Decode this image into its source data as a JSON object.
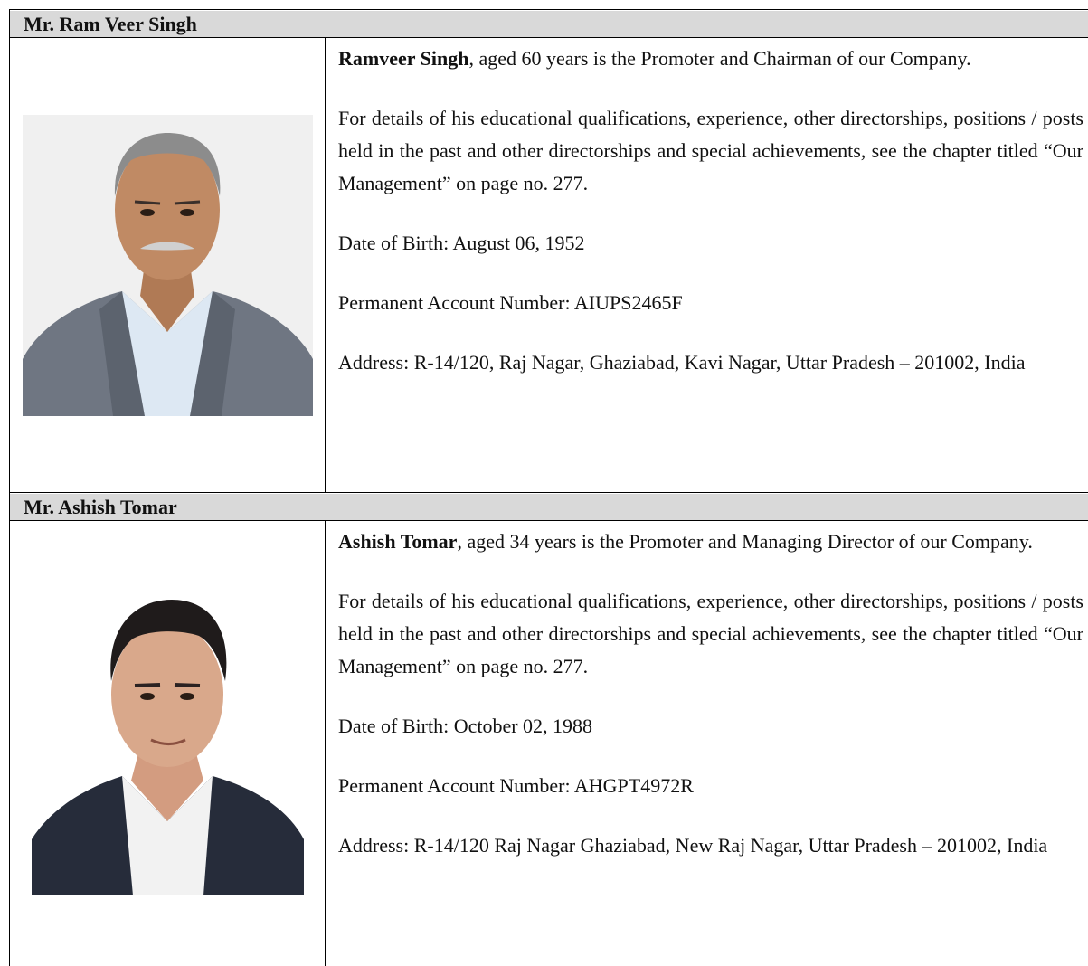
{
  "promoters": [
    {
      "header": "Mr. Ram Veer Singh",
      "name_bold": "Ramveer Singh",
      "intro": ", aged 60 years is the Promoter and Chairman of our Company.",
      "details": "For details of his educational qualifications, experience, other directorships, positions / posts held in the past and other directorships and special achievements, see the chapter titled “Our Management” on page no. 277.",
      "dob": "Date of Birth: August 06, 1952",
      "pan": "Permanent Account Number: AIUPS2465F",
      "address": "Address: R-14/120, Raj Nagar, Ghaziabad, Kavi Nagar, Uttar Pradesh – 201002, India"
    },
    {
      "header": "Mr. Ashish Tomar",
      "name_bold": "Ashish Tomar",
      "intro": ", aged 34 years is the Promoter and Managing Director of our Company.",
      "details": "For details of his educational qualifications, experience, other directorships, positions / posts held in the past and other directorships and special achievements, see the chapter titled “Our Management” on page no. 277.",
      "dob": "Date of Birth: October 02, 1988",
      "pan": "Permanent Account Number: AHGPT4972R",
      "address": "Address: R-14/120 Raj Nagar Ghaziabad, New Raj Nagar, Uttar Pradesh – 201002, India"
    }
  ]
}
